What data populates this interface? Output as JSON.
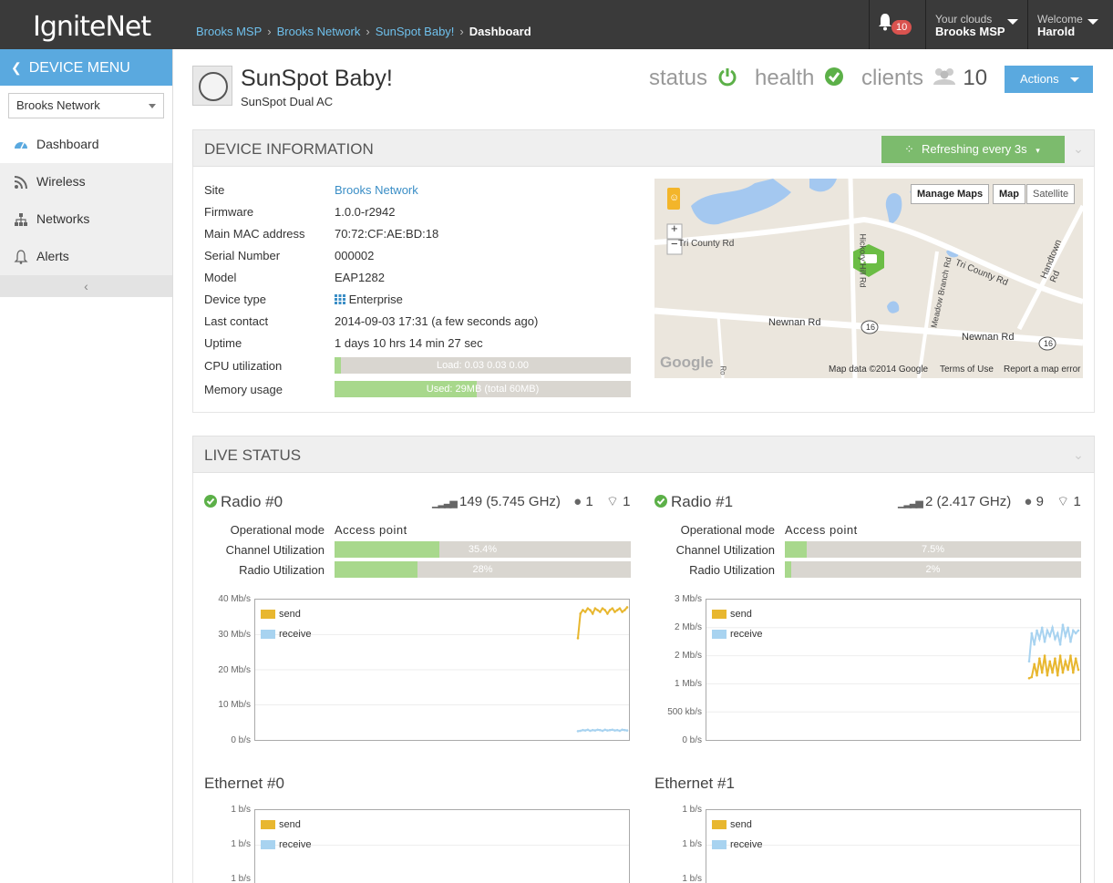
{
  "topbar": {
    "logo": "IgniteNet",
    "breadcrumbs": [
      "Brooks MSP",
      "Brooks Network",
      "SunSpot Baby!"
    ],
    "current": "Dashboard",
    "notifications": "10",
    "clouds_label": "Your clouds",
    "clouds_value": "Brooks MSP",
    "welcome_label": "Welcome",
    "welcome_user": "Harold"
  },
  "sidebar": {
    "title": "DEVICE MENU",
    "network_select": "Brooks Network",
    "items": [
      {
        "label": "Dashboard",
        "icon": "dashboard-icon"
      },
      {
        "label": "Wireless",
        "icon": "wifi-icon"
      },
      {
        "label": "Networks",
        "icon": "network-icon"
      },
      {
        "label": "Alerts",
        "icon": "bell-icon"
      }
    ]
  },
  "device": {
    "name": "SunSpot Baby!",
    "model": "SunSpot Dual AC",
    "status_label": "status",
    "health_label": "health",
    "clients_label": "clients",
    "clients_count": "10",
    "actions_label": "Actions"
  },
  "device_info": {
    "title": "DEVICE INFORMATION",
    "refresh_label": "Refreshing every 3s",
    "rows": [
      {
        "label": "Site",
        "value": "Brooks Network"
      },
      {
        "label": "Firmware",
        "value": "1.0.0-r2942"
      },
      {
        "label": "Main MAC address",
        "value": "70:72:CF:AE:BD:18"
      },
      {
        "label": "Serial Number",
        "value": "000002"
      },
      {
        "label": "Model",
        "value": "EAP1282"
      },
      {
        "label": "Device type",
        "value": "Enterprise"
      },
      {
        "label": "Last contact",
        "value": "2014-09-03 17:31 (a few seconds ago)"
      },
      {
        "label": "Uptime",
        "value": "1 days 10 hrs 14 min 27 sec"
      },
      {
        "label": "CPU utilization",
        "value": "Load: 0.03 0.03 0.00"
      },
      {
        "label": "Memory usage",
        "value": "Used: 29MB (total 60MB)"
      }
    ],
    "cpu_fraction": 0.02,
    "mem_fraction": 0.48
  },
  "map": {
    "manage_maps": "Manage Maps",
    "map_btn": "Map",
    "satellite_btn": "Satellite",
    "zoom_in": "+",
    "zoom_out": "−",
    "roads": [
      "Tri County Rd",
      "Tri County Rd",
      "Newnan Rd",
      "Newnan Rd",
      "Handtown Rd",
      "Meadow Branch Rd",
      "Hickory Hill Rd"
    ],
    "route_badges": [
      "16",
      "16"
    ],
    "attribution": "Map data ©2014 Google",
    "terms": "Terms of Use",
    "report": "Report a map error",
    "google": "Google",
    "partial_road": "Ro"
  },
  "live_status": {
    "title": "LIVE STATUS",
    "radios": [
      {
        "title": "Radio #0",
        "channel": "149 (5.745 GHz)",
        "clients": "1",
        "ssids": "1",
        "op_mode_label": "Operational mode",
        "op_mode": "Access point",
        "chan_util_label": "Channel Utilization",
        "chan_util": "35.4%",
        "chan_util_frac": 0.354,
        "radio_util_label": "Radio Utilization",
        "radio_util": "28%",
        "radio_util_frac": 0.28,
        "y_ticks": [
          "40 Mb/s",
          "30 Mb/s",
          "20 Mb/s",
          "10 Mb/s",
          "0 b/s"
        ]
      },
      {
        "title": "Radio #1",
        "channel": "2 (2.417 GHz)",
        "clients": "9",
        "ssids": "1",
        "op_mode_label": "Operational mode",
        "op_mode": "Access point",
        "chan_util_label": "Channel Utilization",
        "chan_util": "7.5%",
        "chan_util_frac": 0.075,
        "radio_util_label": "Radio Utilization",
        "radio_util": "2%",
        "radio_util_frac": 0.02,
        "y_ticks": [
          "3 Mb/s",
          "2 Mb/s",
          "2 Mb/s",
          "1 Mb/s",
          "500 kb/s",
          "0 b/s"
        ]
      }
    ],
    "ethernet": [
      {
        "title": "Ethernet #0",
        "y_ticks": [
          "1 b/s",
          "1 b/s",
          "1 b/s"
        ]
      },
      {
        "title": "Ethernet #1",
        "y_ticks": [
          "1 b/s",
          "1 b/s",
          "1 b/s"
        ]
      }
    ],
    "legend": {
      "send": "send",
      "receive": "receive"
    },
    "colors": {
      "send": "#e8b72f",
      "receive": "#a8d3f0"
    }
  },
  "chart_data": [
    {
      "type": "line",
      "ylabel": "",
      "ylim": [
        0,
        40
      ],
      "unit": "Mb/s",
      "series": [
        {
          "name": "send",
          "values": [
            29,
            36,
            37,
            36.5,
            37.5,
            37,
            36,
            37.5,
            37,
            36.5,
            37.5,
            37,
            36,
            37,
            37.5,
            36.5,
            37,
            37.5,
            36.5,
            37,
            37.8
          ]
        },
        {
          "name": "receive",
          "values": [
            2.5,
            2.6,
            2.8,
            2.7,
            2.9,
            2.6,
            2.8,
            2.7,
            2.9,
            2.8,
            2.6,
            2.9,
            2.7,
            2.8,
            2.9,
            2.7,
            2.8,
            2.6,
            2.9,
            2.8,
            2.7
          ]
        }
      ]
    },
    {
      "type": "line",
      "ylabel": "",
      "ylim": [
        0,
        2.5
      ],
      "unit": "Mb/s",
      "series": [
        {
          "name": "send",
          "values": [
            1.1,
            1.12,
            1.35,
            1.15,
            1.45,
            1.2,
            1.5,
            1.15,
            1.4,
            1.2,
            1.45,
            1.15,
            1.5,
            1.2,
            1.4,
            1.25,
            1.5,
            1.2,
            1.45,
            1.25
          ]
        },
        {
          "name": "receive",
          "values": [
            1.4,
            1.9,
            1.7,
            1.95,
            1.8,
            2.0,
            1.75,
            1.95,
            1.85,
            2.0,
            1.8,
            1.9,
            1.7,
            2.05,
            1.85,
            2.0,
            1.75,
            1.95,
            1.9,
            1.95
          ]
        }
      ]
    }
  ]
}
